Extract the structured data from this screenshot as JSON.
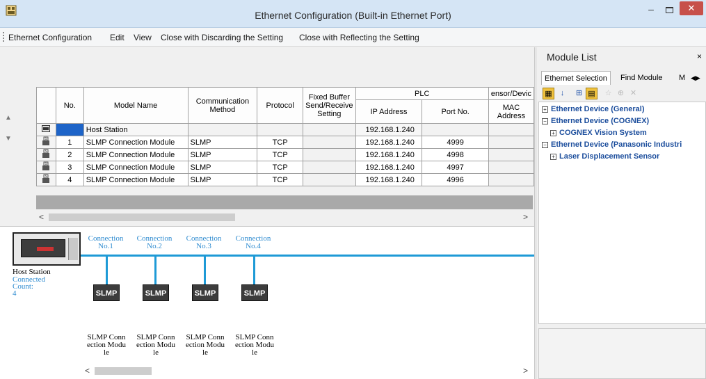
{
  "window": {
    "title": "Ethernet Configuration (Built-in Ethernet Port)",
    "minimize_glyph": "–",
    "close_glyph": "✕",
    "icon_name": "app-grid-icon"
  },
  "menu": {
    "items": [
      "Ethernet Configuration",
      "Edit",
      "View",
      "Close with Discarding the Setting",
      "Close with Reflecting the Setting"
    ]
  },
  "grid": {
    "headers": {
      "no": "No.",
      "model": "Model Name",
      "comm": "Communication Method",
      "protocol": "Protocol",
      "fixed": "Fixed Buffer Send/Receive Setting",
      "plc": "PLC",
      "ip": "IP Address",
      "port": "Port No.",
      "sensor": "ensor/Devic",
      "mac": "MAC Address"
    },
    "host_row": {
      "model": "Host Station",
      "ip": "192.168.1.240"
    },
    "rows": [
      {
        "no": "1",
        "model": "SLMP Connection Module",
        "comm": "SLMP",
        "protocol": "TCP",
        "ip": "192.168.1.240",
        "port": "4999"
      },
      {
        "no": "2",
        "model": "SLMP Connection Module",
        "comm": "SLMP",
        "protocol": "TCP",
        "ip": "192.168.1.240",
        "port": "4998"
      },
      {
        "no": "3",
        "model": "SLMP Connection Module",
        "comm": "SLMP",
        "protocol": "TCP",
        "ip": "192.168.1.240",
        "port": "4997"
      },
      {
        "no": "4",
        "model": "SLMP Connection Module",
        "comm": "SLMP",
        "protocol": "TCP",
        "ip": "192.168.1.240",
        "port": "4996"
      }
    ]
  },
  "diagram": {
    "host_label": "Host Station",
    "connected_label": "Connected Count:",
    "connected_count": "4",
    "connections": [
      {
        "label": "Connection No.1",
        "device": "SLMP",
        "name": "SLMP Conn\nection Modu\nle"
      },
      {
        "label": "Connection No.2",
        "device": "SLMP",
        "name": "SLMP Conn\nection Modu\nle"
      },
      {
        "label": "Connection No.3",
        "device": "SLMP",
        "name": "SLMP Conn\nection Modu\nle"
      },
      {
        "label": "Connection No.4",
        "device": "SLMP",
        "name": "SLMP Conn\nection Modu\nle"
      }
    ]
  },
  "module_list": {
    "title": "Module List",
    "close_glyph": "×",
    "tabs": [
      "Ethernet Selection",
      "Find Module",
      "M"
    ],
    "tree": [
      {
        "label": "Ethernet Device (General)",
        "level": 0
      },
      {
        "label": "Ethernet Device (COGNEX)",
        "level": 0
      },
      {
        "label": "COGNEX Vision System",
        "level": 1
      },
      {
        "label": "Ethernet Device (Panasonic Industri",
        "level": 0
      },
      {
        "label": "Laser Displacement Sensor",
        "level": 1
      }
    ]
  },
  "colors": {
    "accent": "#1e9ad6",
    "selection": "#1e64c8",
    "close_button": "#c7504a",
    "tree_text": "#1b4d9c"
  }
}
